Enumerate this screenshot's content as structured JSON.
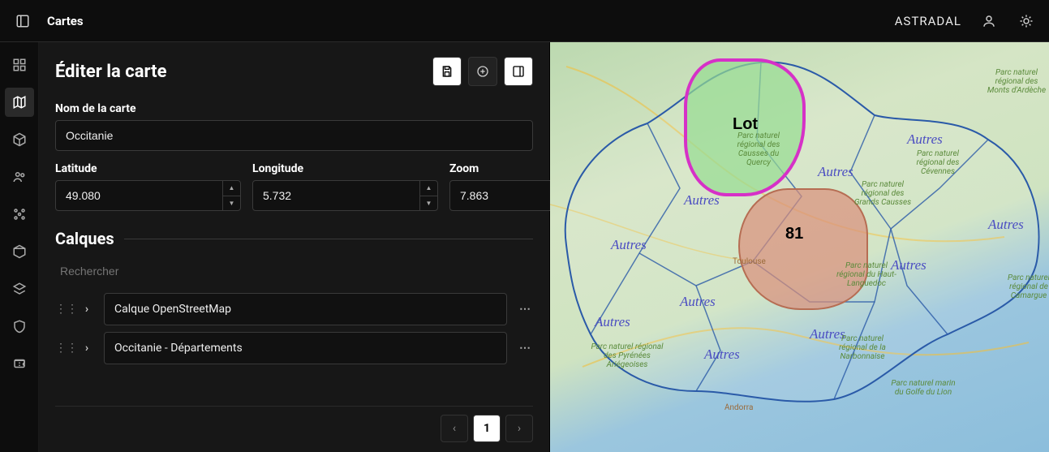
{
  "header": {
    "title": "Cartes",
    "brand": "ASTRADAL"
  },
  "panel": {
    "title": "Éditer la carte",
    "name_label": "Nom de la carte",
    "name_value": "Occitanie",
    "lat_label": "Latitude",
    "lat_value": "49.080",
    "lon_label": "Longitude",
    "lon_value": "5.732",
    "zoom_label": "Zoom",
    "zoom_value": "7.863",
    "layers_title": "Calques",
    "search_placeholder": "Rechercher",
    "layers": [
      {
        "label": "Calque OpenStreetMap"
      },
      {
        "label": "Occitanie - Départements"
      }
    ],
    "page_current": "1"
  },
  "map": {
    "dept_lot_label": "Lot",
    "dept_81_label": "81",
    "other_labels": [
      "Autres",
      "Autres",
      "Autres",
      "Autres",
      "Autres",
      "Autres",
      "Autres",
      "Autres",
      "Autres",
      "Autres"
    ],
    "parks": [
      "Parc naturel régional des Monts d'Ardèche",
      "Parc naturel régional des Causses du Quercy",
      "Parc naturel régional des Grands Causses",
      "Parc naturel régional des Cévennes",
      "Parc naturel régional du Haut-Languedoc",
      "Parc naturel régional des Pyrénées Ariégeoises",
      "Parc naturel régional de la Narbonnaise",
      "Parc naturel marin du Golfe du Lion",
      "Parc naturel régional de Camargue"
    ],
    "towns": [
      "Toulouse",
      "Andorra"
    ]
  }
}
